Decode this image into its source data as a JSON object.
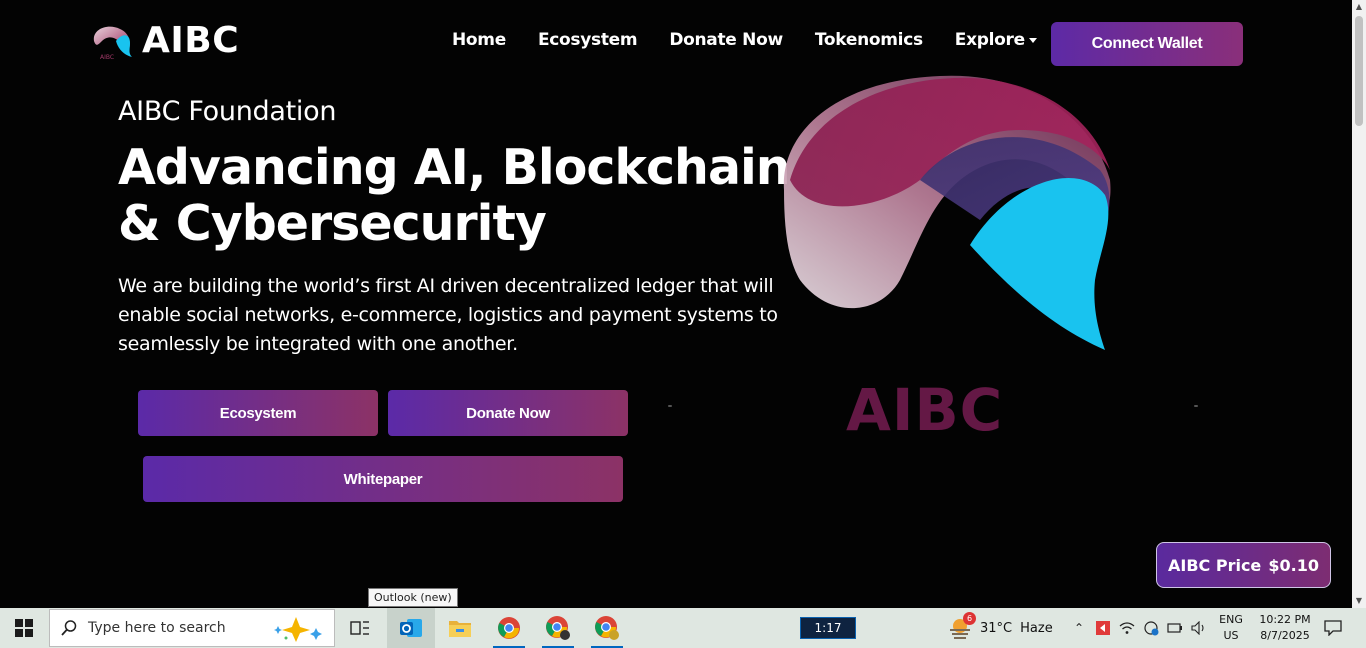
{
  "site": {
    "logo_text": "AIBC",
    "nav": [
      {
        "label": "Home"
      },
      {
        "label": "Ecosystem"
      },
      {
        "label": "Donate Now"
      },
      {
        "label": "Tokenomics"
      },
      {
        "label": "Explore"
      }
    ],
    "connect_wallet": "Connect Wallet",
    "hero": {
      "kicker": "AIBC Foundation",
      "headline": "Advancing AI, Blockchain & Cybersecurity",
      "description": "We are building the world’s first AI driven decentralized ledger that will enable social networks, e-commerce, logistics and payment systems to seamlessly be integrated with one another.",
      "buttons": {
        "ecosystem": "Ecosystem",
        "donate": "Donate Now",
        "whitepaper": "Whitepaper"
      },
      "art_text": "AIBC"
    },
    "price": {
      "label": "AIBC Price",
      "value": "$0.10"
    },
    "colors": {
      "accent_start": "#5d2aa6",
      "accent_end": "#8c3266",
      "art_cyan": "#19c3ef",
      "art_magenta": "#9a2459"
    }
  },
  "tooltip": "Outlook (new)",
  "taskbar": {
    "search_placeholder": "Type here to search",
    "timer": "1:17",
    "weather": {
      "badge": "6",
      "temp": "31°C",
      "condition": "Haze"
    },
    "language": {
      "line1": "ENG",
      "line2": "US"
    },
    "clock": {
      "time": "10:22 PM",
      "date": "8/7/2025"
    },
    "icons": [
      "windows-icon",
      "search-icon",
      "copilot-icon",
      "task-view-icon",
      "outlook-icon",
      "file-explorer-icon",
      "chrome-icon",
      "chrome-profile-icon",
      "chrome-profile-2-icon"
    ]
  }
}
